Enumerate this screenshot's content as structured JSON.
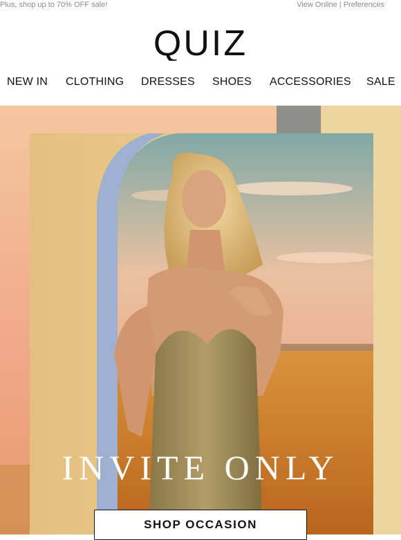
{
  "preheader": {
    "promo_text": "Plus, shop up to 70% OFF sale!",
    "view_online": "View Online",
    "separator": "|",
    "preferences": "Preferences"
  },
  "brand": {
    "logo_text": "QUIZ"
  },
  "nav": {
    "items": [
      "NEW IN",
      "CLOTHING",
      "DRESSES",
      "SHOES",
      "ACCESSORIES",
      "SALE"
    ]
  },
  "hero": {
    "headline": "INVITE ONLY",
    "cta_label": "SHOP OCCASION"
  },
  "colors": {
    "sky_top": "#f2c9a3",
    "wall": "#e7c98a",
    "arch_blue": "#9db0cf",
    "field": "#c8802c",
    "dress": "#9d8a58",
    "text_grey": "#8a8a8a"
  }
}
